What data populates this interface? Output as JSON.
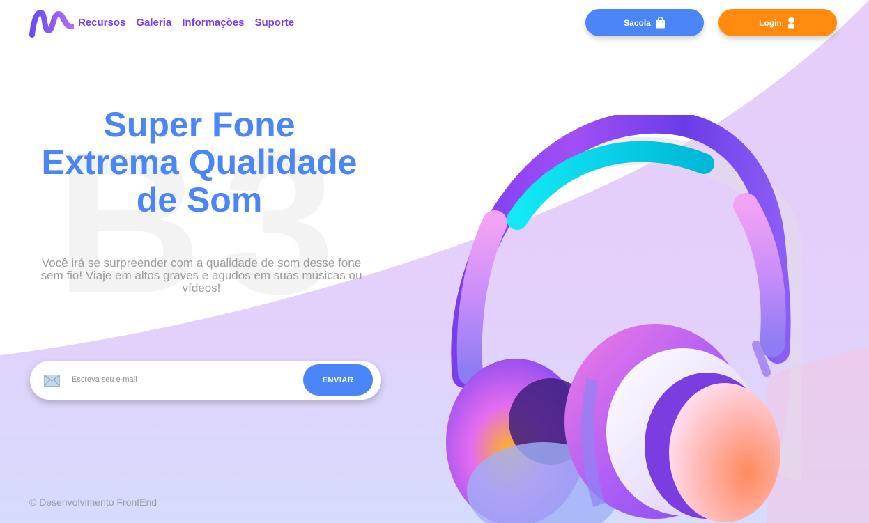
{
  "nav": {
    "logo_icon": "m-wave-logo",
    "links": [
      "Recursos",
      "Galeria",
      "Informações",
      "Suporte"
    ]
  },
  "header": {
    "bag_label": "Sacola",
    "bag_icon": "shopping-bag-icon",
    "login_label": "Login",
    "login_icon": "user-icon"
  },
  "hero": {
    "watermark": "B3",
    "title_lines": [
      "Super Fone",
      "Extrema Qualidade",
      "de Som"
    ],
    "description": "Você irá se surpreender com a qualidade de som desse fone sem fio! Viaje em altos graves e agudos em suas músicas ou vídeos!"
  },
  "newsletter": {
    "icon": "mail-icon",
    "placeholder": "Escreva seu e-mail",
    "value": "",
    "button_label": "ENVIAR"
  },
  "footer": {
    "text": "© Desenvolvimento FrontEnd"
  },
  "colors": {
    "primary_blue": "#4a86f7",
    "nav_purple": "#7a3ff2",
    "login_orange": "#ff8a0d",
    "swoosh_lavender": "#e6cdfa"
  }
}
